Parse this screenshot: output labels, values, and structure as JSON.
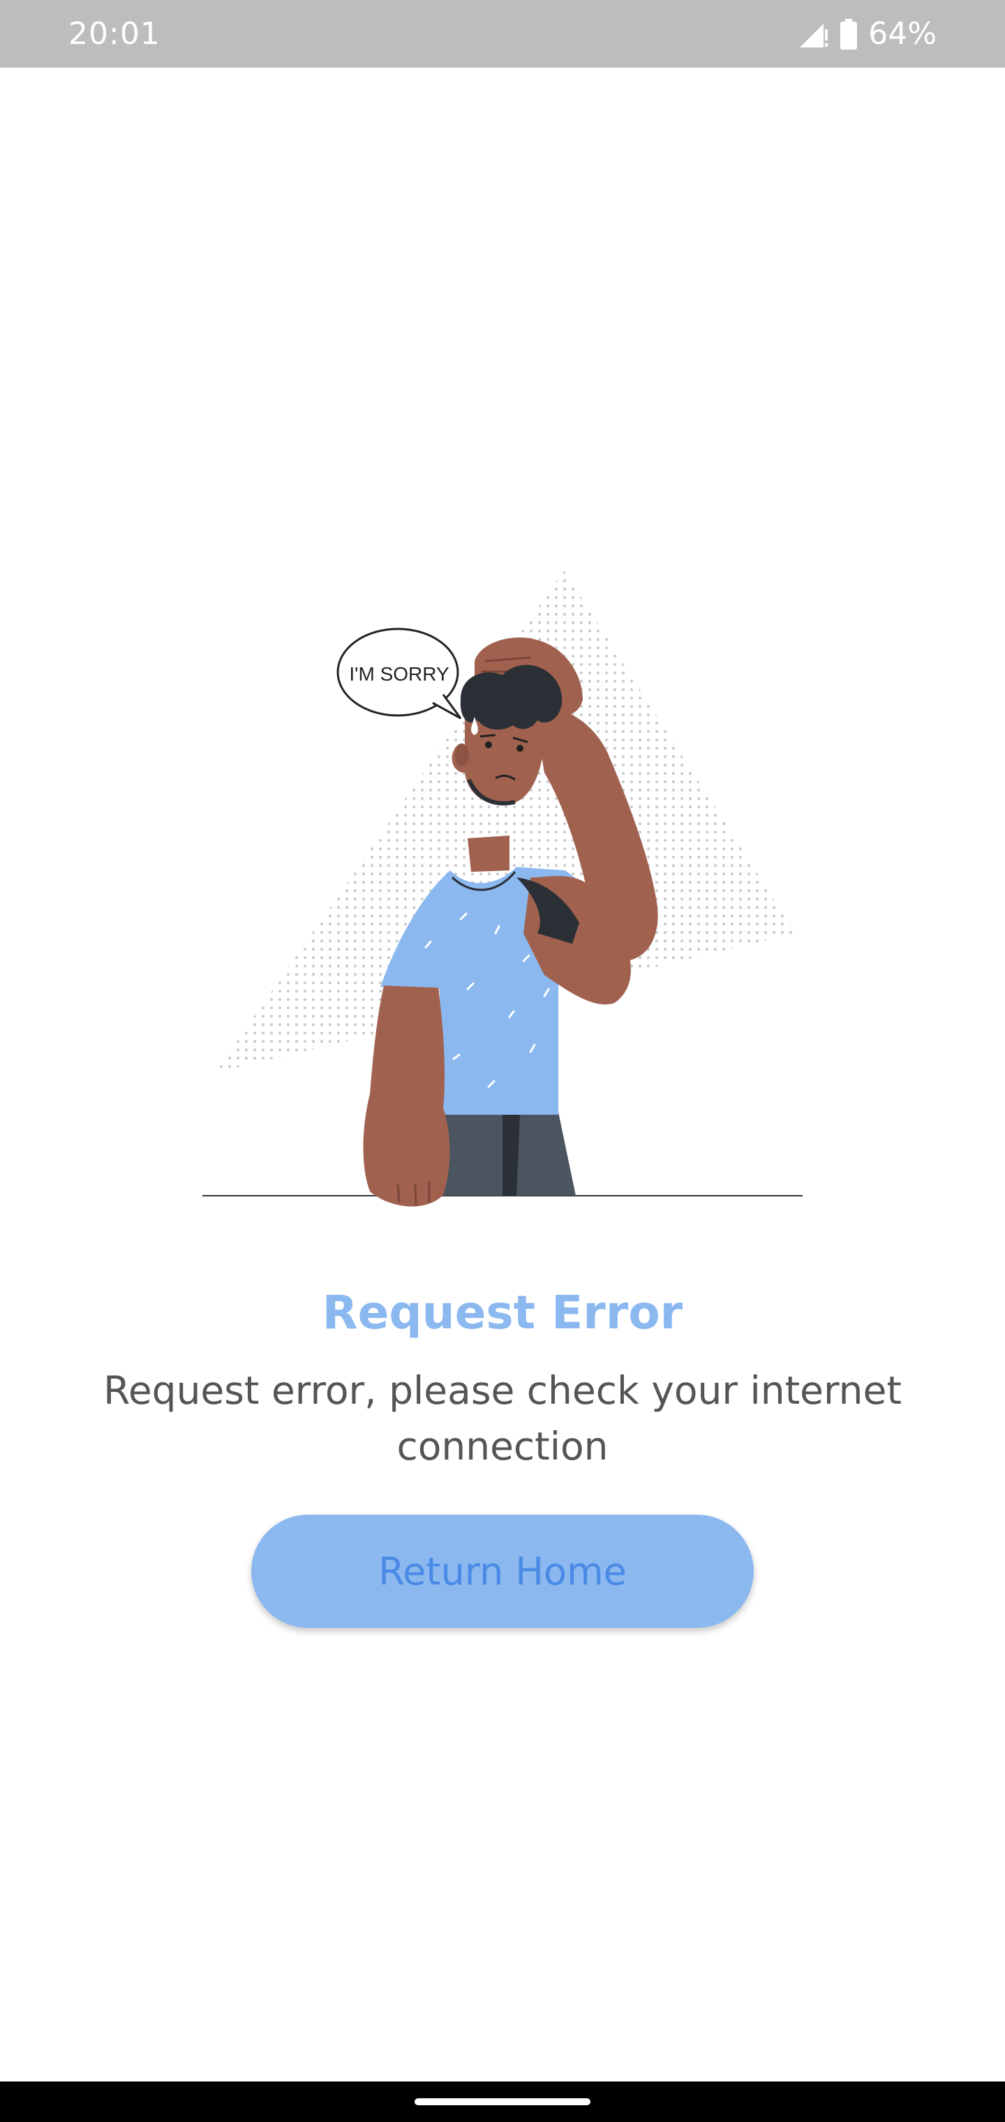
{
  "status_bar": {
    "time": "20:01",
    "battery_percent": "64%",
    "icons": [
      "signal-icon",
      "battery-icon"
    ],
    "background": "#bdbdbd"
  },
  "illustration": {
    "speech_bubble_text": "I'M SORRY",
    "skin_color": "#a0614f",
    "shirt_color": "#8ab8ef",
    "pants_color": "#4a5560",
    "hair_color": "#2b2f36"
  },
  "error": {
    "title": "Request Error",
    "message": "Request error, please check your internet connection"
  },
  "button": {
    "label": "Return Home"
  },
  "colors": {
    "accent": "#8ab8ef",
    "button_text": "#4a8ae6",
    "message_text": "#555555"
  }
}
